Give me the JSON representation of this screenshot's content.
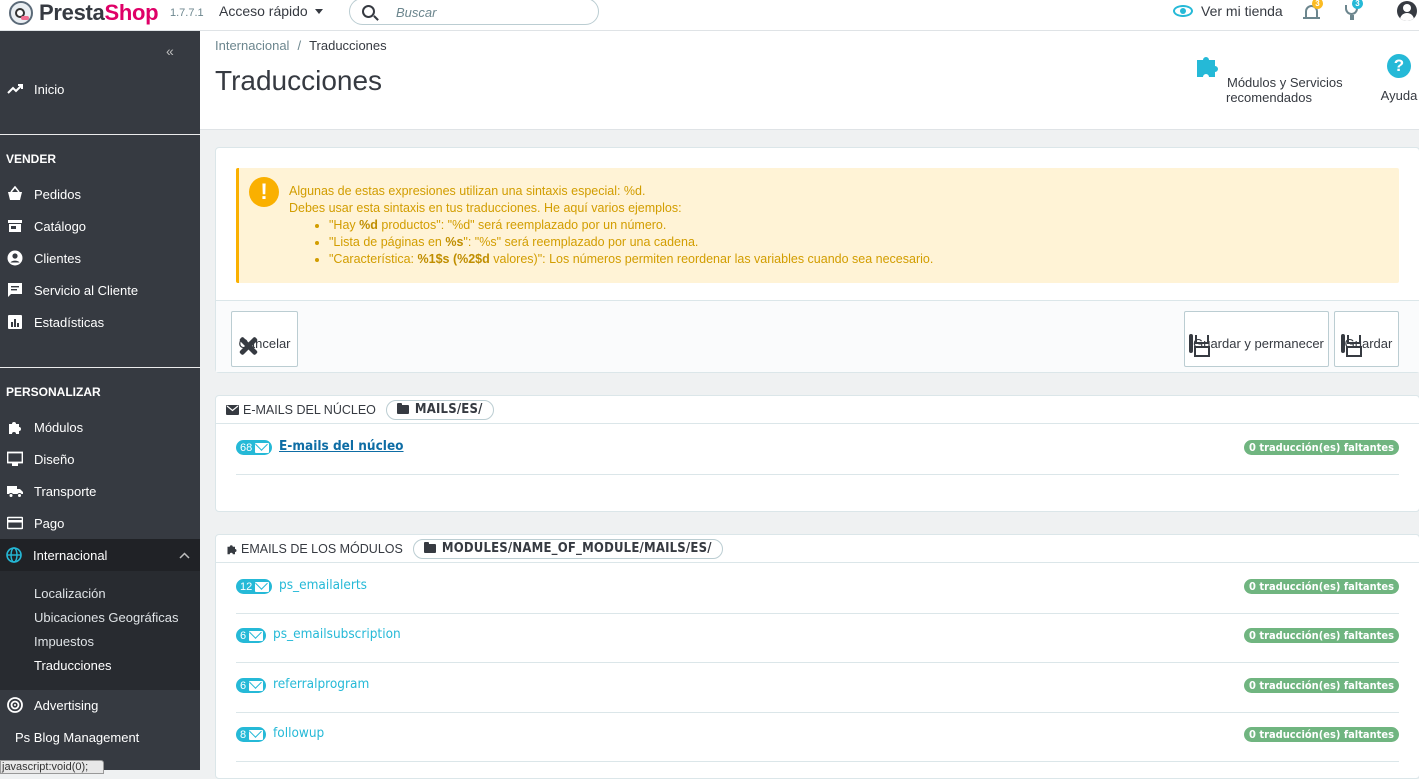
{
  "topbar": {
    "logo_text_presta": "Presta",
    "logo_text_shop": "Shop",
    "version": "1.7.7.1",
    "quick_access": "Acceso rápido",
    "search_placeholder": "Buscar",
    "view_store": "Ver mi tienda",
    "notifications_count": "3",
    "trophy_count": "3",
    "accent_color": "#25b9d7",
    "notif_badge_color": "#fbbb22",
    "trophy_badge_color": "#25b9d7"
  },
  "sidebar": {
    "collapse_icon": "«",
    "home": "Inicio",
    "sell_title": "VENDER",
    "sell_items": [
      "Pedidos",
      "Catálogo",
      "Clientes",
      "Servicio al Cliente",
      "Estadísticas"
    ],
    "customize_title": "PERSONALIZAR",
    "customize_items": [
      "Módulos",
      "Diseño",
      "Transporte",
      "Pago"
    ],
    "international": "Internacional",
    "international_sub": [
      "Localización",
      "Ubicaciones Geográficas",
      "Impuestos",
      "Traducciones"
    ],
    "more_items": [
      "Advertising",
      "Ps Blog Management"
    ]
  },
  "status_bar": "javascript:void(0);",
  "header": {
    "breadcrumb_parent": "Internacional",
    "breadcrumb_sep": "/",
    "breadcrumb_current": "Traducciones",
    "title": "Traducciones",
    "modules_btn": "Módulos y Servicios recomendados",
    "help_btn": "Ayuda",
    "help_icon_glyph": "?"
  },
  "alert": {
    "icon_glyph": "!",
    "line1": "Algunas de estas expresiones utilizan una sintaxis especial: %d.",
    "line2": "Debes usar esta sintaxis en tus traducciones. He aquí varios ejemplos:",
    "ex1_a": "\"Hay ",
    "ex1_b": "%d",
    "ex1_c": " productos\": \"%d\" será reemplazado por un número.",
    "ex2_a": "\"Lista de páginas en ",
    "ex2_b": "%s",
    "ex2_c": "\": \"%s\" será reemplazado por una cadena.",
    "ex3_a": "\"Característica: ",
    "ex3_b": "%1$s (%2$d",
    "ex3_c": " valores)\": Los números permiten reordenar las variables cuando sea necesario."
  },
  "actions": {
    "cancel": "Cancelar",
    "save_stay": "Guardar y permanecer",
    "save": "Guardar"
  },
  "core_emails": {
    "heading": "E-MAILS DEL NÚCLEO",
    "path": "MAILS/ES/",
    "rows": [
      {
        "count": "68",
        "name": "E-mails del núcleo",
        "missing": "0 traducción(es) faltantes"
      }
    ]
  },
  "module_emails": {
    "heading": "EMAILS DE LOS MÓDULOS",
    "path": "MODULES/NAME_OF_MODULE/MAILS/ES/",
    "rows": [
      {
        "count": "12",
        "name": "ps_emailalerts",
        "missing": "0 traducción(es) faltantes"
      },
      {
        "count": "6",
        "name": "ps_emailsubscription",
        "missing": "0 traducción(es) faltantes"
      },
      {
        "count": "6",
        "name": "referralprogram",
        "missing": "0 traducción(es) faltantes"
      },
      {
        "count": "8",
        "name": "followup",
        "missing": "0 traducción(es) faltantes"
      }
    ]
  },
  "icons": {
    "home": "trending-up-icon",
    "orders": "basket-icon",
    "catalog": "store-icon",
    "customers": "account-circle-icon",
    "service": "chat-icon",
    "stats": "bar-chart-icon",
    "modules": "puzzle-icon",
    "design": "desktop-icon",
    "shipping": "truck-icon",
    "payment": "credit-card-icon",
    "international": "globe-icon",
    "advertising": "target-icon"
  }
}
